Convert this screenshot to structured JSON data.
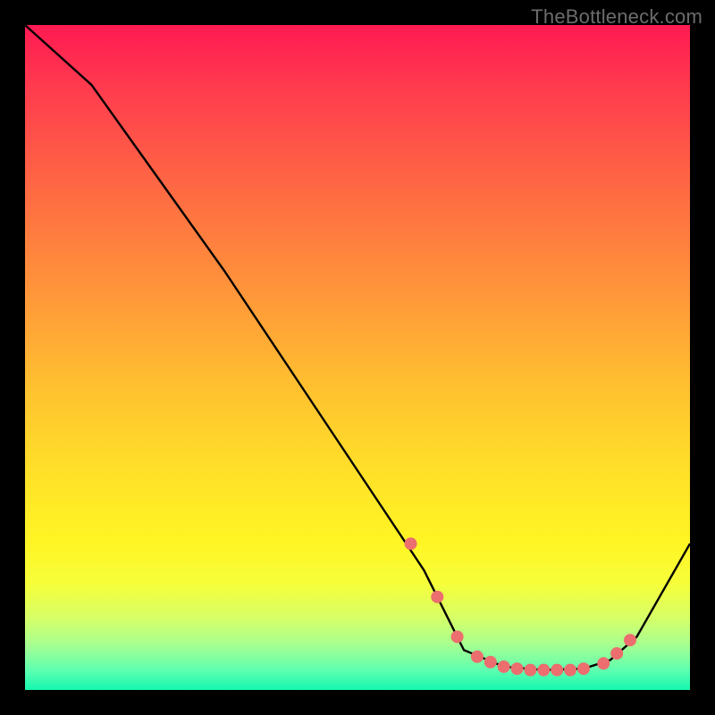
{
  "watermark": "TheBottleneck.com",
  "chart_data": {
    "type": "line",
    "title": "",
    "xlabel": "",
    "ylabel": "",
    "xlim": [
      0,
      100
    ],
    "ylim": [
      0,
      100
    ],
    "grid": false,
    "series": [
      {
        "name": "curve",
        "x": [
          0,
          10,
          20,
          30,
          40,
          50,
          60,
          62,
          66,
          72,
          78,
          84,
          88,
          92,
          100
        ],
        "y": [
          100,
          91,
          77,
          63,
          48,
          33,
          18,
          14,
          6,
          3.5,
          3.0,
          3.2,
          4.5,
          8,
          22
        ]
      }
    ],
    "markers": {
      "name": "highlighted-points",
      "x": [
        58,
        62,
        65,
        68,
        70,
        72,
        74,
        76,
        78,
        80,
        82,
        84,
        87,
        89,
        91
      ],
      "y": [
        22,
        14,
        8,
        5,
        4.2,
        3.5,
        3.2,
        3.0,
        3.0,
        3.0,
        3.0,
        3.2,
        4.0,
        5.5,
        7.5
      ],
      "color": "#ec6e6e",
      "radius": 7
    },
    "colors": {
      "curve": "#000000",
      "marker": "#ec6e6e",
      "gradient_top": "#ff1a52",
      "gradient_bottom": "#15f7b0",
      "background": "#000000",
      "watermark": "#6c6c6c"
    }
  }
}
